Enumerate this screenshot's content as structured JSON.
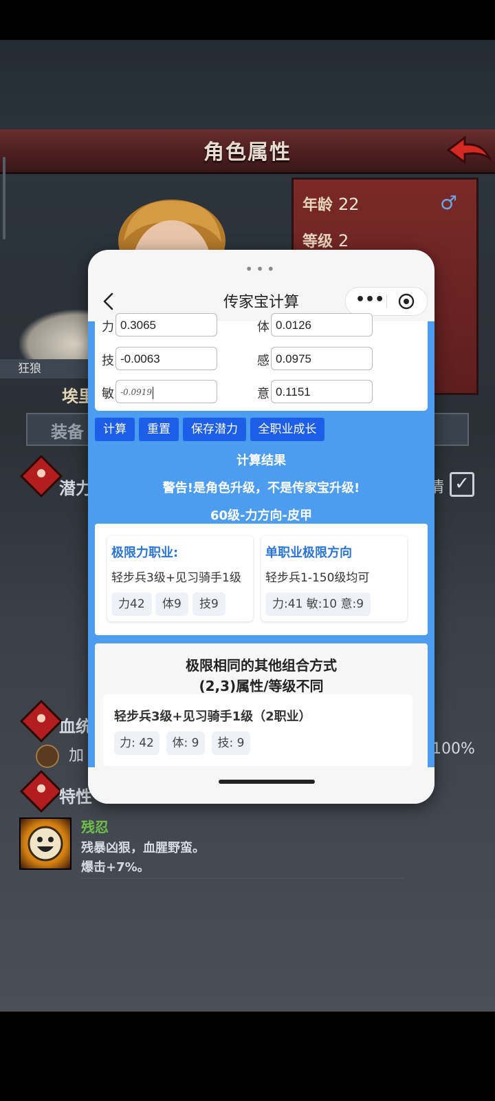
{
  "game": {
    "header_title": "角色属性",
    "info": {
      "age_label": "年龄",
      "age_value": "22",
      "level_label": "等级",
      "level_value": "2"
    },
    "nickname": "狂狼",
    "char_name_partial": "埃里",
    "equip_tab_partial": "装备",
    "section_potential_partial": "潜力",
    "partial_right_text": "情",
    "section_bloodline_partial": "血统",
    "bloodline_row_partial": "加",
    "bloodline_percent": "100%",
    "section_traits_partial": "特性",
    "trait": {
      "name": "残忍",
      "desc1": "残暴凶狠，血腥野蛮。",
      "desc2": "爆击+7%。"
    }
  },
  "popup": {
    "title": "传家宝计算",
    "fields": [
      {
        "label": "力",
        "value": "0.3065"
      },
      {
        "label": "体",
        "value": "0.0126"
      },
      {
        "label": "技",
        "value": "-0.0063"
      },
      {
        "label": "感",
        "value": "0.0975"
      },
      {
        "label": "敏",
        "value": "-0.0919"
      },
      {
        "label": "意",
        "value": "0.1151"
      }
    ],
    "buttons": {
      "calculate": "计算",
      "reset": "重置",
      "save_potential": "保存潜力",
      "all_class_growth": "全职业成长"
    },
    "result_title": "计算结果",
    "warning": "警告!是角色升级，不是传家宝升级!",
    "direction": "60级-力方向-皮甲",
    "limit_class": {
      "title": "极限力职业:",
      "desc": "轻步兵3级+见习骑手1级",
      "chips": [
        "力42",
        "体9",
        "技9"
      ]
    },
    "single_class": {
      "title": "单职业极限方向",
      "desc": "轻步兵1-150级均可",
      "chip": "力:41 敏:10 意:9"
    },
    "combo": {
      "title1": "极限相同的其他组合方式",
      "title2": "(2,3)属性/等级不同",
      "item_name": "轻步兵3级+见习骑手1级（2职业）",
      "chips": [
        "力: 42",
        "体: 9",
        "技: 9"
      ]
    }
  },
  "colors": {
    "accent_blue": "#4c9cf0",
    "button_blue": "#1d5ee9",
    "title_blue": "#2a74d6",
    "banner_red": "#6a2e2e"
  },
  "icons": [
    "back-arrow-icon",
    "male-icon",
    "chevron-left-icon",
    "more-dots-icon",
    "target-icon",
    "checkbox-icon",
    "potential-icon",
    "bloodline-icon",
    "trait-icon"
  ]
}
